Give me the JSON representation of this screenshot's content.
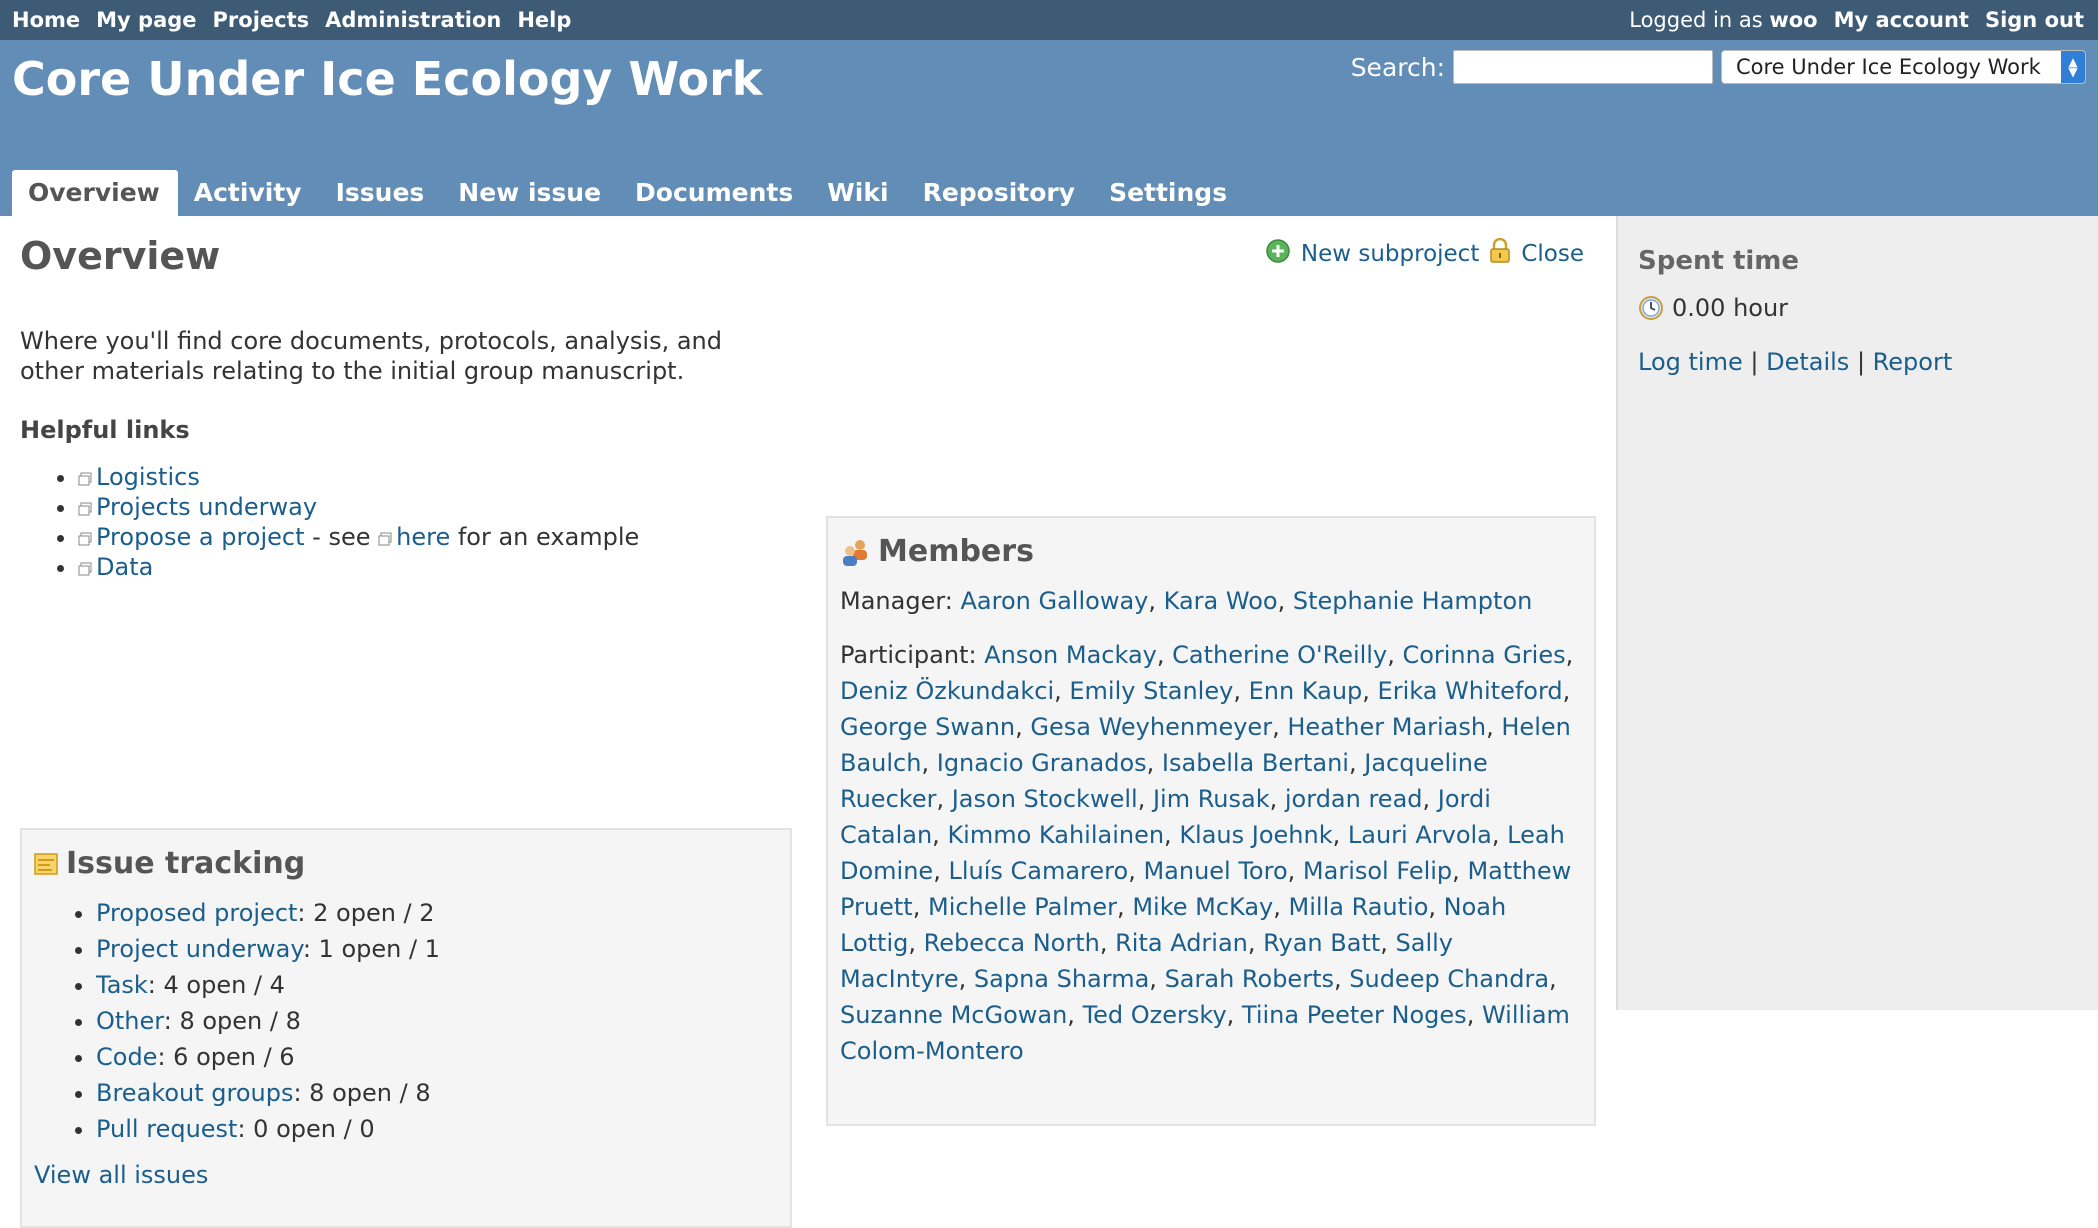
{
  "top_menu": {
    "items": [
      "Home",
      "My page",
      "Projects",
      "Administration",
      "Help"
    ],
    "logged_in_prefix": "Logged in as",
    "user": "woo",
    "my_account": "My account",
    "sign_out": "Sign out"
  },
  "header": {
    "title": "Core Under Ice Ecology Work",
    "search_label": "Search:",
    "search_value": "",
    "project_jump": "Core Under Ice Ecology Work"
  },
  "tabs": [
    "Overview",
    "Activity",
    "Issues",
    "New issue",
    "Documents",
    "Wiki",
    "Repository",
    "Settings"
  ],
  "content": {
    "heading": "Overview",
    "new_subproject": "New subproject",
    "close": "Close",
    "description_line1": "Where you'll find core documents, protocols, analysis, and",
    "description_line2": "other materials relating to the initial group manuscript.",
    "helpful_heading": "Helpful links",
    "links": {
      "logistics": "Logistics",
      "projects_underway": "Projects underway",
      "propose": "Propose a project",
      "see": " - see ",
      "here": "here",
      "for_example": " for an example",
      "data": "Data"
    }
  },
  "issue_tracking": {
    "heading": "Issue tracking",
    "trackers": [
      {
        "name": "Proposed project",
        "counts": ": 2 open / 2"
      },
      {
        "name": "Project underway",
        "counts": ": 1 open / 1"
      },
      {
        "name": "Task",
        "counts": ": 4 open / 4"
      },
      {
        "name": "Other",
        "counts": ": 8 open / 8"
      },
      {
        "name": "Code",
        "counts": ": 6 open / 6"
      },
      {
        "name": "Breakout groups",
        "counts": ": 8 open / 8"
      },
      {
        "name": "Pull request",
        "counts": ": 0 open / 0"
      }
    ],
    "view_all": "View all issues"
  },
  "members": {
    "heading": "Members",
    "manager_label": "Manager:",
    "managers": [
      "Aaron Galloway",
      "Kara Woo",
      "Stephanie Hampton"
    ],
    "participant_label": "Participant:",
    "participants": [
      "Anson Mackay",
      "Catherine O'Reilly",
      "Corinna Gries",
      "Deniz Özkundakci",
      "Emily Stanley",
      "Enn Kaup",
      "Erika Whiteford",
      "George Swann",
      "Gesa Weyhenmeyer",
      "Heather Mariash",
      "Helen Baulch",
      "Ignacio Granados",
      "Isabella Bertani",
      "Jacqueline Ruecker",
      "Jason Stockwell",
      "Jim Rusak",
      "jordan read",
      "Jordi Catalan",
      "Kimmo Kahilainen",
      "Klaus Joehnk",
      "Lauri Arvola",
      "Leah Domine",
      "Lluís Camarero",
      "Manuel Toro",
      "Marisol Felip",
      "Matthew Pruett",
      "Michelle Palmer",
      "Mike McKay",
      "Milla Rautio",
      "Noah Lottig",
      "Rebecca North",
      "Rita Adrian",
      "Ryan Batt",
      "Sally MacIntyre",
      "Sapna Sharma",
      "Sarah Roberts",
      "Sudeep Chandra",
      "Suzanne McGowan",
      "Ted Ozersky",
      "Tiina Peeter Noges",
      "William Colom-Montero"
    ]
  },
  "sidebar": {
    "heading": "Spent time",
    "hours": "0.00 hour",
    "log_time": "Log time",
    "details": "Details",
    "report": "Report",
    "sep": "|"
  }
}
